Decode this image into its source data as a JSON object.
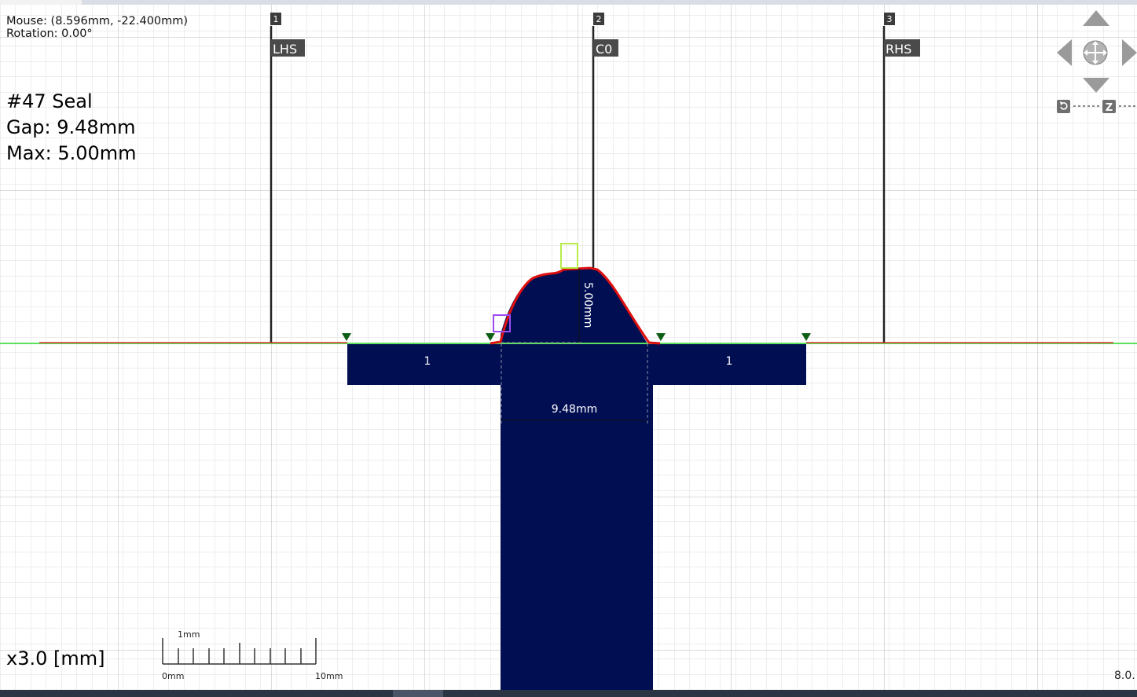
{
  "readout": {
    "mouse": "Mouse: (8.596mm, -22.400mm)",
    "rotation": "Rotation: 0.00°"
  },
  "info": {
    "title": "#47 Seal",
    "gap": "Gap: 9.48mm",
    "max": "Max: 5.00mm"
  },
  "guides": [
    {
      "number": "1",
      "label": "LHS"
    },
    {
      "number": "2",
      "label": "C0"
    },
    {
      "number": "3",
      "label": "RHS"
    }
  ],
  "plates": {
    "left_label": "1",
    "right_label": "1"
  },
  "dimensions": {
    "height": "5.00mm",
    "gap": "9.48mm"
  },
  "scale_bar": {
    "unit_label": "1mm",
    "start_label": "0mm",
    "end_label": "10mm"
  },
  "zoom": "x3.0 [mm]",
  "edge_value": "8.0.",
  "nav_icons": [
    "arrow-up-icon",
    "arrow-down-icon",
    "arrow-left-icon",
    "arrow-right-icon",
    "pan-center-icon",
    "rotate-icon",
    "zoom-z-icon"
  ],
  "colors": {
    "grid": "#dcdcdc",
    "grid_major": "#b9b9b9",
    "baseline": "#5fe05f",
    "profile": "#e01010",
    "plate_fill": "#010e52",
    "guide_line": "#222222",
    "marker": "#0b5d13",
    "nav_icon": "#9a9a9a"
  }
}
